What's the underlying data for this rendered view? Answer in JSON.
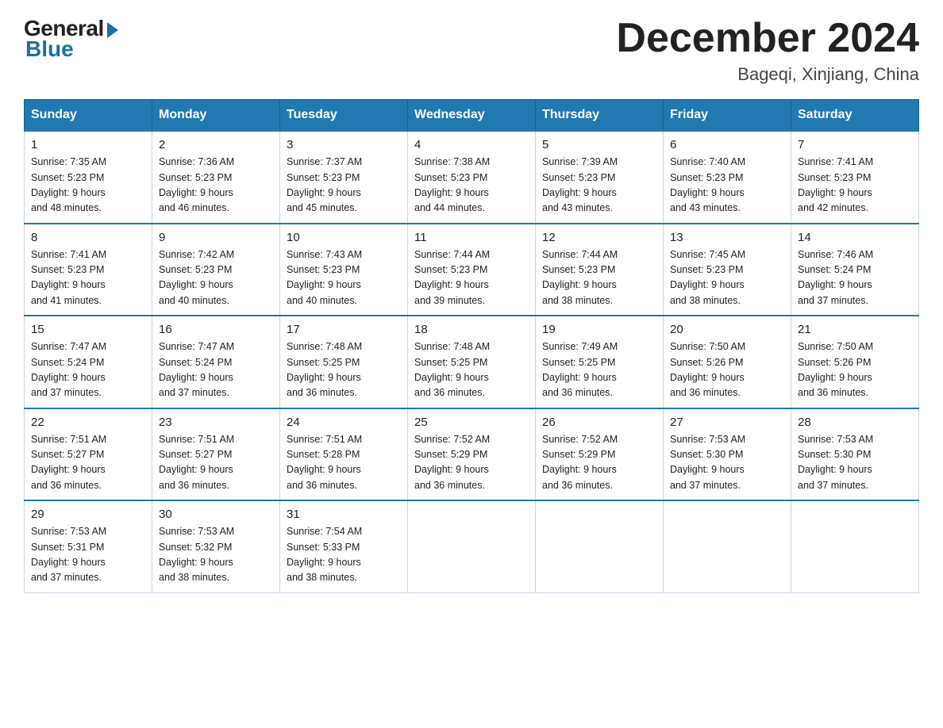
{
  "logo": {
    "general": "General",
    "blue": "Blue"
  },
  "title": {
    "month": "December 2024",
    "location": "Bageqi, Xinjiang, China"
  },
  "headers": [
    "Sunday",
    "Monday",
    "Tuesday",
    "Wednesday",
    "Thursday",
    "Friday",
    "Saturday"
  ],
  "weeks": [
    [
      {
        "day": "1",
        "sunrise": "7:35 AM",
        "sunset": "5:23 PM",
        "daylight": "9 hours and 48 minutes."
      },
      {
        "day": "2",
        "sunrise": "7:36 AM",
        "sunset": "5:23 PM",
        "daylight": "9 hours and 46 minutes."
      },
      {
        "day": "3",
        "sunrise": "7:37 AM",
        "sunset": "5:23 PM",
        "daylight": "9 hours and 45 minutes."
      },
      {
        "day": "4",
        "sunrise": "7:38 AM",
        "sunset": "5:23 PM",
        "daylight": "9 hours and 44 minutes."
      },
      {
        "day": "5",
        "sunrise": "7:39 AM",
        "sunset": "5:23 PM",
        "daylight": "9 hours and 43 minutes."
      },
      {
        "day": "6",
        "sunrise": "7:40 AM",
        "sunset": "5:23 PM",
        "daylight": "9 hours and 43 minutes."
      },
      {
        "day": "7",
        "sunrise": "7:41 AM",
        "sunset": "5:23 PM",
        "daylight": "9 hours and 42 minutes."
      }
    ],
    [
      {
        "day": "8",
        "sunrise": "7:41 AM",
        "sunset": "5:23 PM",
        "daylight": "9 hours and 41 minutes."
      },
      {
        "day": "9",
        "sunrise": "7:42 AM",
        "sunset": "5:23 PM",
        "daylight": "9 hours and 40 minutes."
      },
      {
        "day": "10",
        "sunrise": "7:43 AM",
        "sunset": "5:23 PM",
        "daylight": "9 hours and 40 minutes."
      },
      {
        "day": "11",
        "sunrise": "7:44 AM",
        "sunset": "5:23 PM",
        "daylight": "9 hours and 39 minutes."
      },
      {
        "day": "12",
        "sunrise": "7:44 AM",
        "sunset": "5:23 PM",
        "daylight": "9 hours and 38 minutes."
      },
      {
        "day": "13",
        "sunrise": "7:45 AM",
        "sunset": "5:23 PM",
        "daylight": "9 hours and 38 minutes."
      },
      {
        "day": "14",
        "sunrise": "7:46 AM",
        "sunset": "5:24 PM",
        "daylight": "9 hours and 37 minutes."
      }
    ],
    [
      {
        "day": "15",
        "sunrise": "7:47 AM",
        "sunset": "5:24 PM",
        "daylight": "9 hours and 37 minutes."
      },
      {
        "day": "16",
        "sunrise": "7:47 AM",
        "sunset": "5:24 PM",
        "daylight": "9 hours and 37 minutes."
      },
      {
        "day": "17",
        "sunrise": "7:48 AM",
        "sunset": "5:25 PM",
        "daylight": "9 hours and 36 minutes."
      },
      {
        "day": "18",
        "sunrise": "7:48 AM",
        "sunset": "5:25 PM",
        "daylight": "9 hours and 36 minutes."
      },
      {
        "day": "19",
        "sunrise": "7:49 AM",
        "sunset": "5:25 PM",
        "daylight": "9 hours and 36 minutes."
      },
      {
        "day": "20",
        "sunrise": "7:50 AM",
        "sunset": "5:26 PM",
        "daylight": "9 hours and 36 minutes."
      },
      {
        "day": "21",
        "sunrise": "7:50 AM",
        "sunset": "5:26 PM",
        "daylight": "9 hours and 36 minutes."
      }
    ],
    [
      {
        "day": "22",
        "sunrise": "7:51 AM",
        "sunset": "5:27 PM",
        "daylight": "9 hours and 36 minutes."
      },
      {
        "day": "23",
        "sunrise": "7:51 AM",
        "sunset": "5:27 PM",
        "daylight": "9 hours and 36 minutes."
      },
      {
        "day": "24",
        "sunrise": "7:51 AM",
        "sunset": "5:28 PM",
        "daylight": "9 hours and 36 minutes."
      },
      {
        "day": "25",
        "sunrise": "7:52 AM",
        "sunset": "5:29 PM",
        "daylight": "9 hours and 36 minutes."
      },
      {
        "day": "26",
        "sunrise": "7:52 AM",
        "sunset": "5:29 PM",
        "daylight": "9 hours and 36 minutes."
      },
      {
        "day": "27",
        "sunrise": "7:53 AM",
        "sunset": "5:30 PM",
        "daylight": "9 hours and 37 minutes."
      },
      {
        "day": "28",
        "sunrise": "7:53 AM",
        "sunset": "5:30 PM",
        "daylight": "9 hours and 37 minutes."
      }
    ],
    [
      {
        "day": "29",
        "sunrise": "7:53 AM",
        "sunset": "5:31 PM",
        "daylight": "9 hours and 37 minutes."
      },
      {
        "day": "30",
        "sunrise": "7:53 AM",
        "sunset": "5:32 PM",
        "daylight": "9 hours and 38 minutes."
      },
      {
        "day": "31",
        "sunrise": "7:54 AM",
        "sunset": "5:33 PM",
        "daylight": "9 hours and 38 minutes."
      },
      null,
      null,
      null,
      null
    ]
  ],
  "labels": {
    "sunrise": "Sunrise:",
    "sunset": "Sunset:",
    "daylight": "Daylight:"
  }
}
